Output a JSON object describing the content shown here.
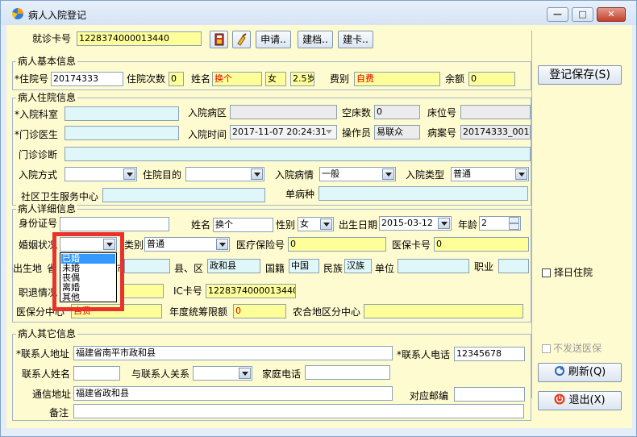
{
  "window": {
    "title": "病人入院登记",
    "controls": {
      "minimize": "—",
      "maximize": "□",
      "close": "✕"
    }
  },
  "top_bar": {
    "card_label": "就诊卡号",
    "card_value": "1228374000013440",
    "apply_btn": "申请..",
    "build_file_btn": "建档..",
    "build_card_btn": "建卡.."
  },
  "basic": {
    "legend": "病人基本信息",
    "admission_no_label": "*住院号",
    "admission_no": "20174333",
    "visits_label": "住院次数",
    "visits": "0",
    "name_label": "姓名",
    "name": "换个",
    "sex": "女",
    "age": "2.5岁",
    "fee_type_label": "费别",
    "fee_type": "自费",
    "balance_label": "余额",
    "balance": "0"
  },
  "hospital": {
    "legend": "病人住院信息",
    "dept_label": "*入院科室",
    "dept": "",
    "ward_label": "入院病区",
    "ward": "",
    "empty_beds_label": "空床数",
    "empty_beds": "0",
    "bed_label": "床位号",
    "bed": "",
    "doctor_label": "*门诊医生",
    "doctor": "",
    "time_label": "入院时间",
    "time": "2017-11-07 20:24:31",
    "operator_label": "操作员",
    "operator": "易联众",
    "case_no_label": "病案号",
    "case_no": "20174333_001",
    "diagnosis_label": "门诊诊断",
    "diagnosis": "",
    "method_label": "入院方式",
    "method": "",
    "purpose_label": "住院目的",
    "purpose": "",
    "condition_label": "入院病情",
    "condition": "一般",
    "type_label": "入院类型",
    "type": "普通",
    "community_label": "社区卫生服务中心",
    "community": "",
    "single_disease_label": "单病种",
    "single_disease": ""
  },
  "detail": {
    "legend": "病人详细信息",
    "id_label": "身份证号",
    "id": "",
    "name_label": "姓名",
    "name": "换个",
    "sex_label": "性别",
    "sex": "女",
    "dob_label": "出生日期",
    "dob": "2015-03-12",
    "age_label": "年龄",
    "age": "2",
    "marital_label": "婚姻状况",
    "marital": "",
    "category_label": "类别",
    "category": "普通",
    "insurance_no_label": "医疗保险号",
    "insurance_no": "0",
    "insurance_card_label": "医保卡号",
    "insurance_card": "0",
    "birthplace_label": "出生地",
    "province_label": "省",
    "city_label": "市",
    "county_label": "县、区",
    "county": "政和县",
    "nationality_label": "国籍",
    "nationality": "中国",
    "ethnicity_label": "民族",
    "ethnicity": "汉族",
    "employer_label": "单位",
    "employer": "",
    "job_label": "职业",
    "job": "",
    "retire_label": "职退情况",
    "retire": "",
    "ic_label": "IC卡号",
    "ic": "1228374000013440",
    "center_label": "医保分中心",
    "center": "自费",
    "quota_label": "年度统筹限额",
    "quota": "0",
    "rural_label": "农合地区分中心",
    "rural": ""
  },
  "marital_options": [
    "已婚",
    "未婚",
    "丧偶",
    "离婚",
    "其他"
  ],
  "other": {
    "legend": "病人其它信息",
    "contact_addr_label": "*联系人地址",
    "contact_addr": "福建省南平市政和县",
    "contact_phone_label": "*联系人电话",
    "contact_phone": "12345678",
    "contact_name_label": "联系人姓名",
    "contact_name": "",
    "relation_label": "与联系人关系",
    "relation": "",
    "home_phone_label": "家庭电话",
    "home_phone": "",
    "mail_addr_label": "通信地址",
    "mail_addr": "福建省政和县",
    "zip_label": "对应邮编",
    "zip": "",
    "note_label": "备注",
    "note": ""
  },
  "side": {
    "save_btn": "登记保存(S)",
    "select_day_label": "择日住院",
    "no_send_label": "不发送医保",
    "refresh_btn": "刷新(Q)",
    "exit_btn": "退出(X)"
  }
}
